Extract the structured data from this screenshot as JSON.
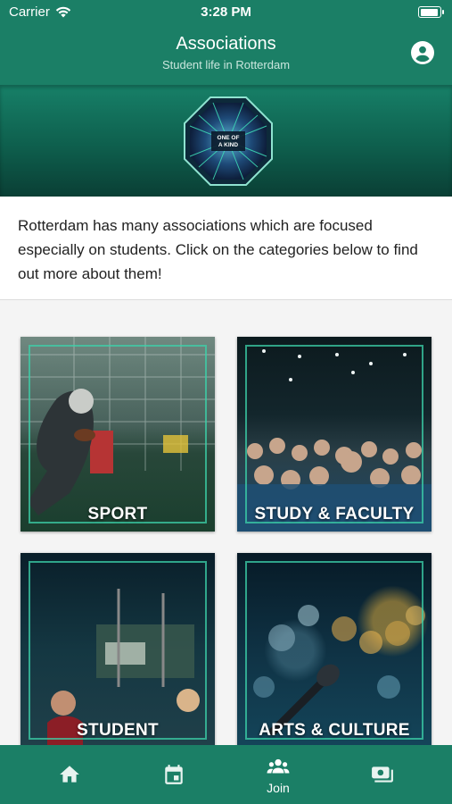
{
  "status_bar": {
    "carrier": "Carrier",
    "time": "3:28 PM"
  },
  "header": {
    "title": "Associations",
    "subtitle": "Student life in Rotterdam",
    "profile_icon": "account-circle-icon"
  },
  "banner": {
    "logo_text_1": "ONE OF",
    "logo_text_2": "A KIND"
  },
  "intro": {
    "text": "Rotterdam has many associations which are focused especially on students. Click on the categories below to find out more about them!"
  },
  "categories": [
    {
      "label": "SPORT"
    },
    {
      "label": "STUDY & FACULTY"
    },
    {
      "label": "STUDENT"
    },
    {
      "label": "ARTS & CULTURE"
    }
  ],
  "tabbar": {
    "items": [
      {
        "icon": "home-icon",
        "label": ""
      },
      {
        "icon": "calendar-icon",
        "label": ""
      },
      {
        "icon": "group-icon",
        "label": "Join"
      },
      {
        "icon": "money-icon",
        "label": ""
      }
    ]
  },
  "colors": {
    "primary": "#1b7f66",
    "accent": "#3cd2aa",
    "text": "#222222"
  }
}
